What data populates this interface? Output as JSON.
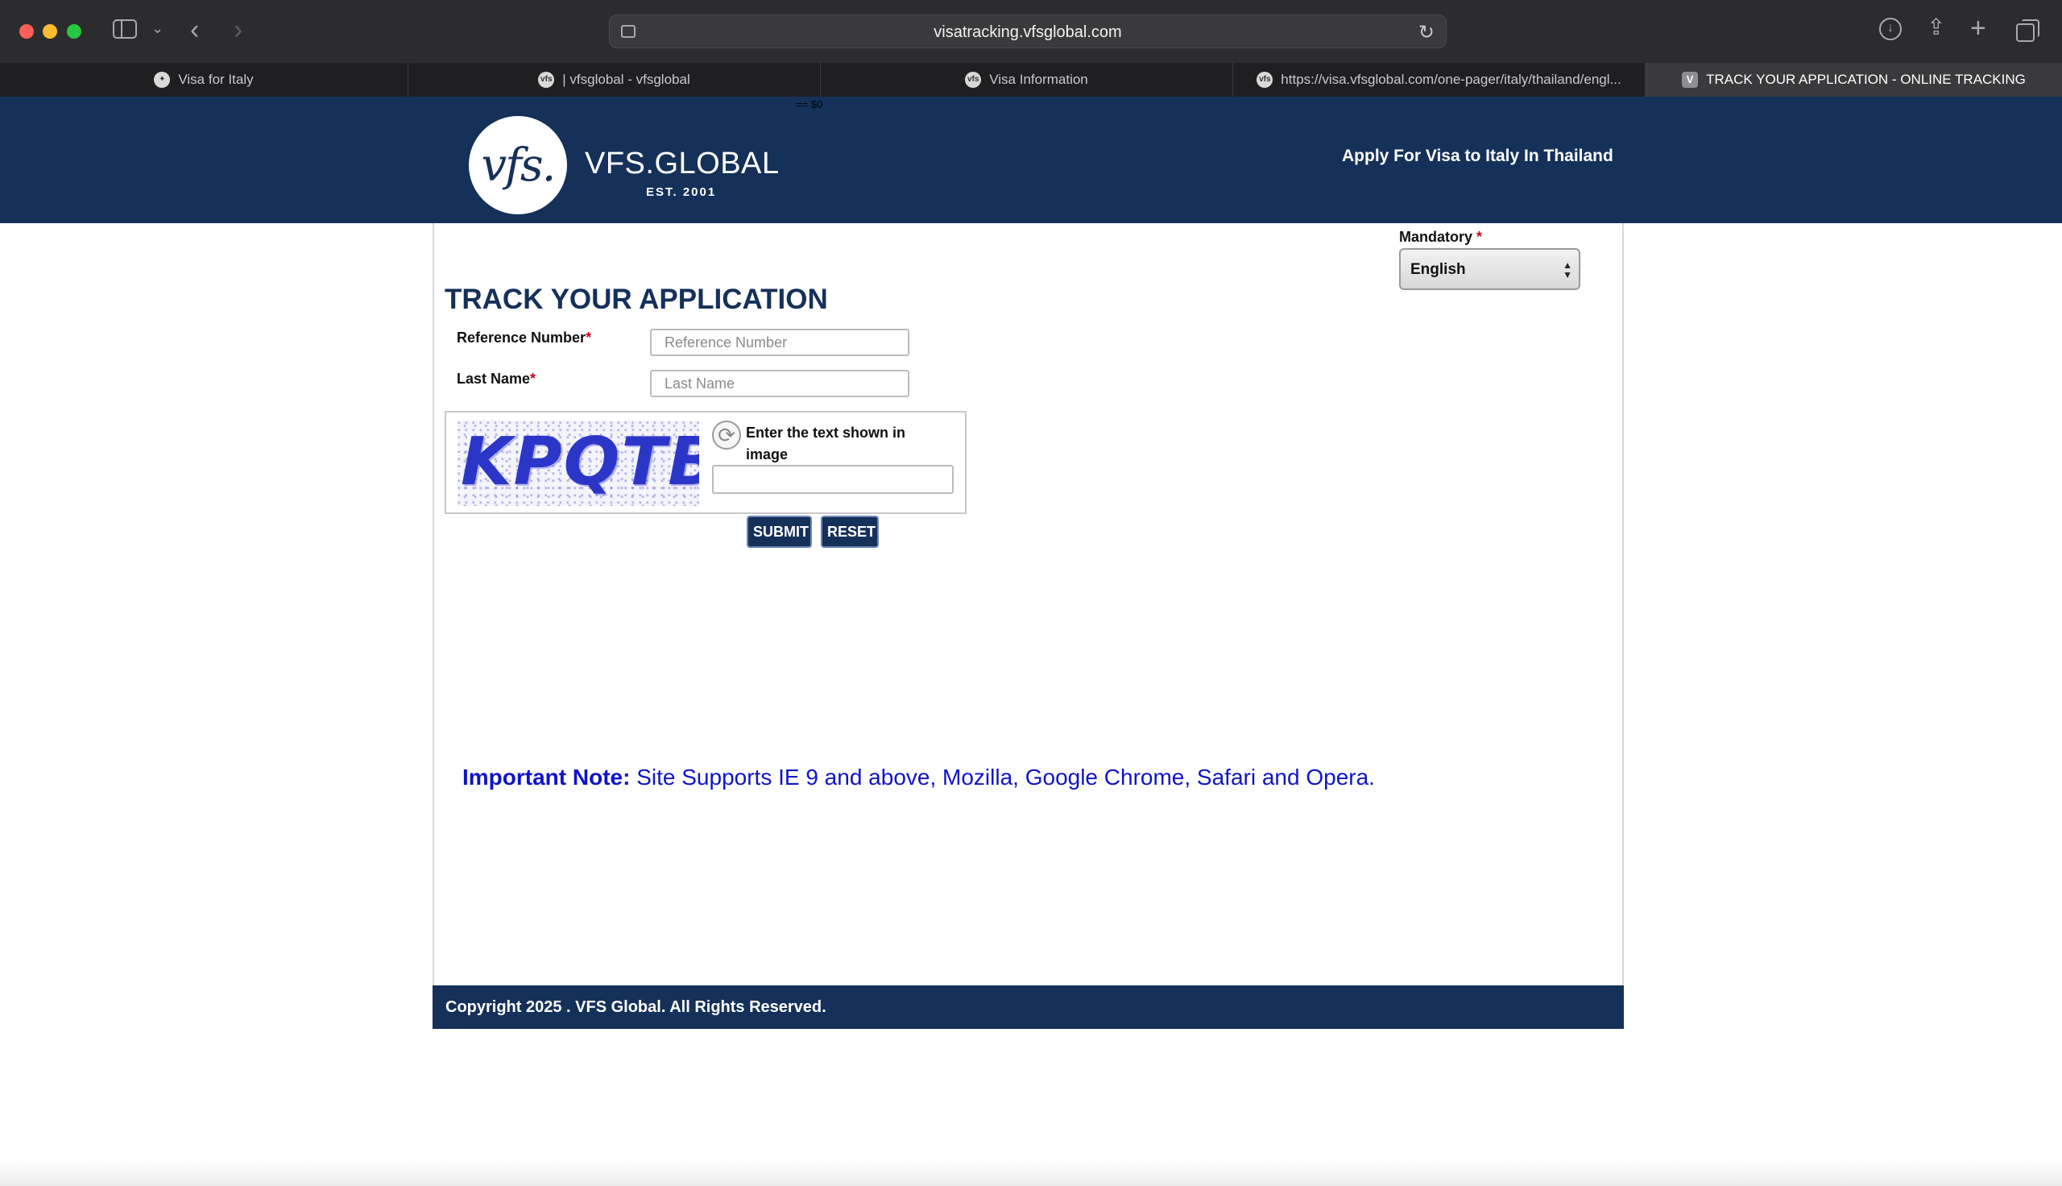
{
  "browser": {
    "url": "visatracking.vfsglobal.com",
    "tabs": [
      {
        "label": "Visa for Italy",
        "favicon": "emblem-favicon",
        "active": false
      },
      {
        "label": "| vfsglobal - vfsglobal",
        "favicon": "vfs-favicon",
        "active": false
      },
      {
        "label": "Visa Information",
        "favicon": "vfs-favicon",
        "active": false
      },
      {
        "label": "https://visa.vfsglobal.com/one-pager/italy/thailand/engl...",
        "favicon": "vfs-favicon",
        "active": false
      },
      {
        "label": "TRACK YOUR APPLICATION - ONLINE TRACKING",
        "favicon": "v-favicon",
        "favicon_text": "V",
        "active": true
      }
    ]
  },
  "header": {
    "debug_text": "== $0",
    "logo_mark": "vfs.",
    "logo_word": "VFS.GLOBAL",
    "logo_est": "EST. 2001",
    "tagline": "Apply For Visa to Italy  In Thailand"
  },
  "language": {
    "label": "Mandatory",
    "required_mark": "*",
    "selected": "English"
  },
  "form": {
    "title": "TRACK YOUR APPLICATION",
    "reference_label": "Reference Number",
    "reference_placeholder": "Reference Number",
    "lastname_label": "Last Name",
    "lastname_placeholder": "Last Name",
    "required_mark": "*",
    "captcha_text": "KPQTB",
    "captcha_prompt": "Enter the text shown in image",
    "submit_label": "SUBMIT",
    "reset_label": "RESET"
  },
  "note": {
    "label": "Important Note:",
    "text": "Site Supports IE 9 and above, Mozilla, Google Chrome, Safari and Opera."
  },
  "footer": {
    "copyright": "Copyright 2025 . VFS Global. All Rights Reserved."
  },
  "colors": {
    "brand_navy": "#15315a",
    "note_blue": "#0f14c8",
    "required_red": "#d0021b"
  }
}
